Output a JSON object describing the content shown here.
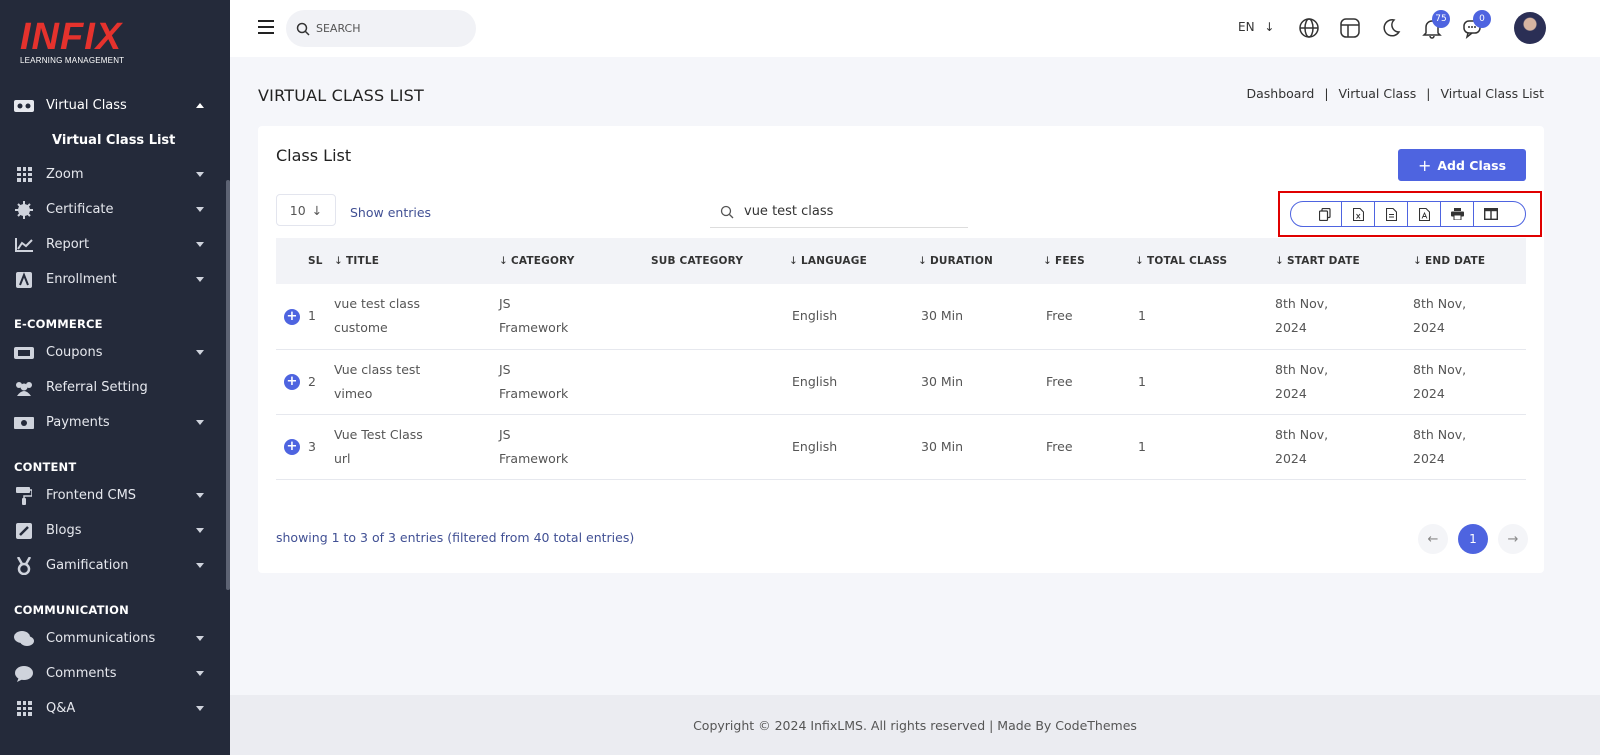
{
  "brand": {
    "logo_text": "INFIX",
    "logo_sub": "LEARNING MANAGEMENT",
    "logo_color": "#e5322d"
  },
  "sidebar": {
    "items": [
      {
        "label": "Virtual Class",
        "icon": "vr-headset-icon"
      },
      {
        "label": "Virtual Class List"
      },
      {
        "label": "Zoom",
        "icon": "grid-icon"
      },
      {
        "label": "Certificate",
        "icon": "certificate-icon"
      },
      {
        "label": "Report",
        "icon": "chart-icon"
      },
      {
        "label": "Enrollment",
        "icon": "enrollment-icon"
      },
      {
        "label": "Coupons",
        "icon": "ticket-icon"
      },
      {
        "label": "Referral Setting",
        "icon": "users-icon"
      },
      {
        "label": "Payments",
        "icon": "money-icon"
      },
      {
        "label": "Frontend CMS",
        "icon": "paint-roller-icon"
      },
      {
        "label": "Blogs",
        "icon": "edit-icon"
      },
      {
        "label": "Gamification",
        "icon": "medal-icon"
      },
      {
        "label": "Communications",
        "icon": "chat-icon"
      },
      {
        "label": "Comments",
        "icon": "comment-icon"
      },
      {
        "label": "Q&A",
        "icon": "grid-icon"
      }
    ],
    "sections": {
      "ecommerce": "E-COMMERCE",
      "content": "CONTENT",
      "communication": "COMMUNICATION"
    }
  },
  "topbar": {
    "search_placeholder": "SEARCH",
    "language": "EN",
    "notifications_count": "75",
    "messages_count": "0"
  },
  "page": {
    "title": "VIRTUAL CLASS LIST",
    "breadcrumb": [
      "Dashboard",
      "|",
      "Virtual Class",
      "|",
      "Virtual Class List"
    ]
  },
  "card": {
    "title": "Class List",
    "add_button": "Add Class",
    "entries_value": "10",
    "show_entries": "Show entries",
    "search_value": "vue test class",
    "export_buttons": [
      "copy-icon",
      "excel-icon",
      "csv-icon",
      "pdf-icon",
      "print-icon",
      "columns-icon"
    ]
  },
  "table": {
    "columns": [
      "SL",
      "TITLE",
      "CATEGORY",
      "SUB CATEGORY",
      "LANGUAGE",
      "DURATION",
      "FEES",
      "TOTAL CLASS",
      "START DATE",
      "END DATE"
    ],
    "rows": [
      {
        "sl": "1",
        "title_1": "vue test class",
        "title_2": "custome",
        "category_1": "JS",
        "category_2": "Framework",
        "sub_category": "",
        "language": "English",
        "duration": "30 Min",
        "fees": "Free",
        "total_class": "1",
        "start_1": "8th Nov,",
        "start_2": "2024",
        "end_1": "8th Nov,",
        "end_2": "2024"
      },
      {
        "sl": "2",
        "title_1": "Vue class test",
        "title_2": "vimeo",
        "category_1": "JS",
        "category_2": "Framework",
        "sub_category": "",
        "language": "English",
        "duration": "30 Min",
        "fees": "Free",
        "total_class": "1",
        "start_1": "8th Nov,",
        "start_2": "2024",
        "end_1": "8th Nov,",
        "end_2": "2024"
      },
      {
        "sl": "3",
        "title_1": "Vue Test Class",
        "title_2": "url",
        "category_1": "JS",
        "category_2": "Framework",
        "sub_category": "",
        "language": "English",
        "duration": "30 Min",
        "fees": "Free",
        "total_class": "1",
        "start_1": "8th Nov,",
        "start_2": "2024",
        "end_1": "8th Nov,",
        "end_2": "2024"
      }
    ]
  },
  "pagination": {
    "info": "showing 1 to 3 of 3 entries (filtered from 40 total entries)",
    "current_page": "1"
  },
  "footer": {
    "text": "Copyright © 2024 InfixLMS. All rights reserved | Made By CodeThemes"
  },
  "colors": {
    "accent": "#4e64e0",
    "sidebar_bg": "#242a3a",
    "highlight": "#e00000"
  }
}
